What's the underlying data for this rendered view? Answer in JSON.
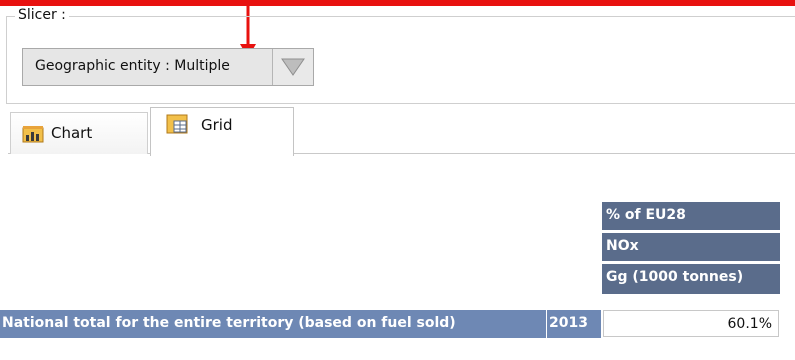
{
  "slicer": {
    "legend": "Slicer :",
    "dropdown_label": "Geographic entity : Multiple"
  },
  "tabs": [
    {
      "label": "Chart",
      "icon": "chart-icon",
      "active": false
    },
    {
      "label": "Grid",
      "icon": "grid-icon",
      "active": true
    }
  ],
  "grid": {
    "column_headers": [
      "% of EU28",
      "NOx",
      "Gg (1000 tonnes)"
    ],
    "rows": [
      {
        "label": "National total for the entire territory (based on fuel sold)",
        "year": "2013",
        "value": "60.1%"
      }
    ]
  },
  "colors": {
    "annotation_red": "#e8110f",
    "header_blue": "#5a6c8b",
    "row_header_blue": "#6e88b4"
  }
}
